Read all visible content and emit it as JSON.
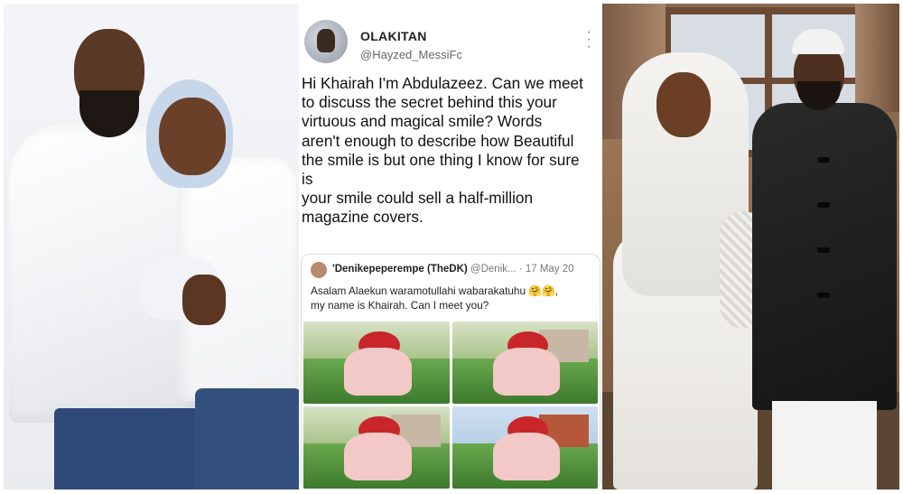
{
  "tweet": {
    "author_name": "OLAKITAN",
    "author_handle": "@Hayzed_MessiFc",
    "more_icon": "more-vertical-icon",
    "body_lines": [
      "Hi Khairah I'm Abdulazeez. Can we meet",
      "to discuss the secret behind this your",
      "virtuous and magical smile? Words",
      "aren't enough to describe how Beautiful",
      "the smile is but one thing I know for sure",
      "is",
      "your smile could sell a half-million",
      "magazine covers."
    ],
    "quoted": {
      "author_name": "'Denikepeperempe (TheDK)",
      "author_handle": "@Denik...",
      "separator": "·",
      "date": "17 May 20",
      "text_line1": "Asalam Alaekun waramotullahi wabarakatuhu 🤗🤗,",
      "text_line2": "my name is Khairah. Can I meet you?",
      "images": [
        "photo-1",
        "photo-2",
        "photo-3",
        "photo-4"
      ]
    }
  },
  "colors": {
    "accent_hijab": "#c8262b",
    "text_primary": "#111111",
    "text_muted": "#666666"
  }
}
